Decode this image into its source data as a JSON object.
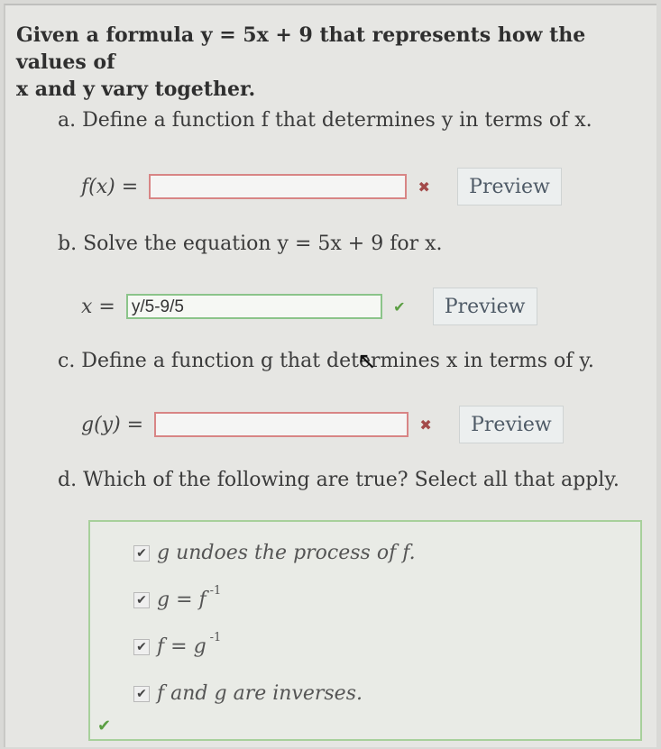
{
  "intro": {
    "line1": "Given a formula y = 5x + 9 that represents how the values of",
    "line2": "x and y vary together."
  },
  "part_a": {
    "prompt": "a. Define a function f that determines y in terms of x.",
    "lhs": "f(x) =",
    "value": "",
    "status_icon": "incorrect-x-icon",
    "status_glyph": "✖",
    "preview_label": "Preview"
  },
  "part_b": {
    "prompt": "b. Solve the equation y = 5x + 9 for x.",
    "lhs": "x =",
    "value": "y/5-9/5",
    "status_icon": "correct-check-icon",
    "status_glyph": "✔",
    "preview_label": "Preview"
  },
  "part_c": {
    "prompt": "c. Define a function g that determines x in terms of y.",
    "lhs": "g(y) =",
    "value": "",
    "status_icon": "incorrect-x-icon",
    "status_glyph": "✖",
    "preview_label": "Preview"
  },
  "part_d": {
    "prompt": "d. Which of the following are true? Select all that apply.",
    "choices": [
      {
        "text": "g undoes the process of f.",
        "checked": true
      },
      {
        "text": "g = f",
        "sup": "-1",
        "checked": true
      },
      {
        "text": "f = g",
        "sup": "-1",
        "checked": true
      },
      {
        "text": "f and g are inverses.",
        "checked": true
      }
    ],
    "check_glyph": "✔",
    "status_glyph": "✔"
  },
  "colors": {
    "correct": "#5a9e42",
    "incorrect": "#a34a4a",
    "correct_border": "#8bc48a",
    "incorrect_border": "#d88585"
  }
}
